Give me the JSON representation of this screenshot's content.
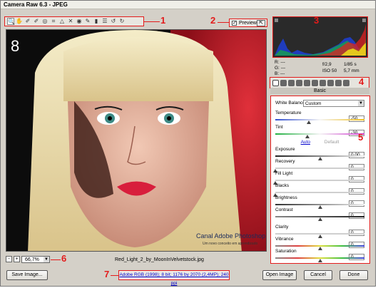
{
  "window": {
    "title": "Camera Raw 6.3 - JPEG"
  },
  "annotations": [
    "1",
    "2",
    "3",
    "4",
    "5",
    "6",
    "7",
    "8"
  ],
  "toolbar": {
    "tools": [
      "zoom-tool",
      "hand-tool",
      "white-balance-tool",
      "color-sampler-tool",
      "targeted-adjustment-tool",
      "crop-tool",
      "straighten-tool",
      "spot-removal-tool",
      "red-eye-tool",
      "adjustment-brush-tool",
      "graduated-filter-tool",
      "preferences-tool",
      "rotate-ccw-tool",
      "rotate-cw-tool"
    ]
  },
  "preview": {
    "label": "Preview",
    "checked": "✓"
  },
  "watermark": {
    "brand": "Canal Adobe Photoshop",
    "tagline": "Um novo conceito em aprendizado"
  },
  "readout": {
    "r": "R:",
    "r_val": "---",
    "g": "G:",
    "g_val": "---",
    "b": "B:",
    "b_val": "---",
    "aperture": "f/2,9",
    "shutter": "1/85 s",
    "iso": "ISO 50",
    "focal": "5,7 mm"
  },
  "section": {
    "title": "Basic"
  },
  "basic": {
    "white_balance_label": "White Balance:",
    "white_balance_value": "Custom",
    "temperature_label": "Temperature",
    "temperature_value": "-50",
    "tint_label": "Tint",
    "tint_value": "-30",
    "auto_label": "Auto",
    "default_label": "Default",
    "exposure_label": "Exposure",
    "exposure_value": "0,00",
    "recovery_label": "Recovery",
    "recovery_value": "0",
    "filllight_label": "Fill Light",
    "filllight_value": "0",
    "blacks_label": "Blacks",
    "blacks_value": "0",
    "brightness_label": "Brightness",
    "brightness_value": "0",
    "contrast_label": "Contrast",
    "contrast_value": "0",
    "clarity_label": "Clarity",
    "clarity_value": "0",
    "vibrance_label": "Vibrance",
    "vibrance_value": "0",
    "saturation_label": "Saturation",
    "saturation_value": "0"
  },
  "zoom": {
    "value": "66,7%",
    "minus": "-",
    "plus": "+"
  },
  "filename": "Red_Light_2_by_MoonInVelvetstock.jpg",
  "footer": {
    "save_label": "Save Image...",
    "workflow_info": "Adobe RGB (1998); 8 bit; 1176 by 2070 (2,4MP); 240 ppi",
    "open_label": "Open Image",
    "cancel_label": "Cancel",
    "done_label": "Done"
  },
  "colors": {
    "annotation": "#e31b1b",
    "panel_bg": "#d4d0c8"
  }
}
